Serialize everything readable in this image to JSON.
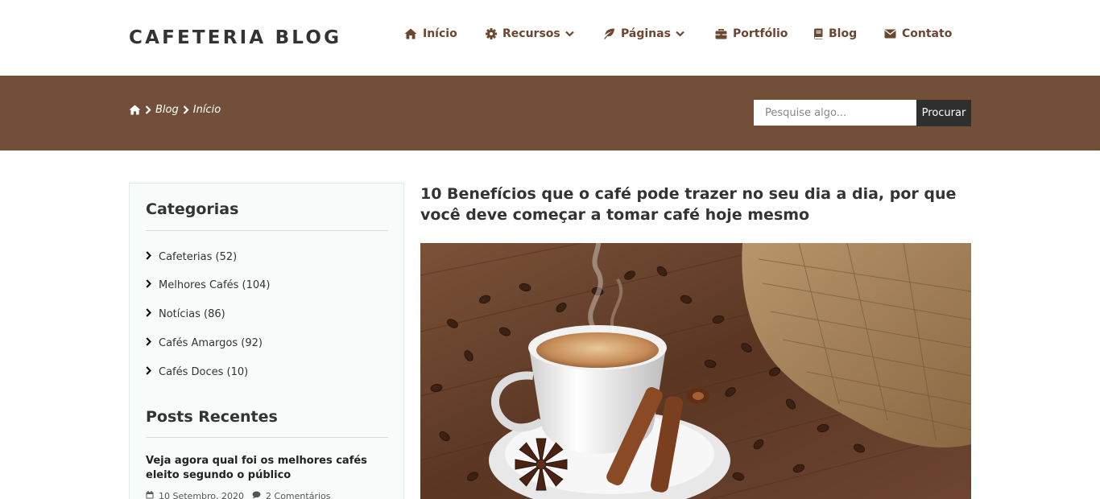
{
  "brand": {
    "logo": "CAFETERIA BLOG"
  },
  "nav": [
    {
      "label": "Início",
      "icon": "home-icon"
    },
    {
      "label": "Recursos",
      "icon": "gear-icon",
      "dropdown": true
    },
    {
      "label": "Páginas",
      "icon": "leaf-icon",
      "dropdown": true
    },
    {
      "label": "Portfólio",
      "icon": "briefcase-icon"
    },
    {
      "label": "Blog",
      "icon": "book-icon"
    },
    {
      "label": "Contato",
      "icon": "envelope-icon"
    }
  ],
  "breadcrumb": {
    "items": [
      "Blog",
      "Início"
    ]
  },
  "search": {
    "placeholder": "Pesquise algo...",
    "button": "Procurar"
  },
  "sidebar": {
    "categories_title": "Categorias",
    "categories": [
      "Cafeterias (52)",
      "Melhores Cafés (104)",
      "Notícias (86)",
      "Cafés Amargos (92)",
      "Cafés Doces (10)"
    ],
    "recent_title": "Posts Recentes",
    "recent_posts": [
      {
        "title": "Veja agora qual foi os melhores cafés eleito segundo o público",
        "date": "10 Setembro, 2020",
        "comments": "2 Comentários"
      }
    ]
  },
  "post": {
    "title": "10 Benefícios que o café pode trazer no seu dia a dia, por que você deve começar a tomar café hoje mesmo",
    "image_alt": "coffee-cup-photo"
  },
  "colors": {
    "brown_banner": "#724f38",
    "nav_brown": "#6b4630",
    "search_button": "#2f2f2f",
    "sidebar_bg": "#f7fbf9"
  }
}
